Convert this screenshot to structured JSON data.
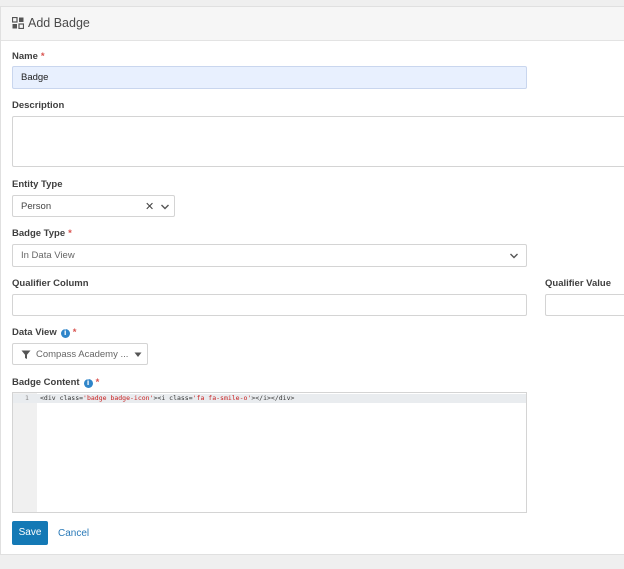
{
  "panel": {
    "title": "Add Badge",
    "icon": "badge-add-icon"
  },
  "fields": {
    "name": {
      "label": "Name",
      "required_mark": "*",
      "value": "Badge"
    },
    "description": {
      "label": "Description",
      "value": ""
    },
    "entity_type": {
      "label": "Entity Type",
      "value": "Person",
      "clear_glyph": "✕"
    },
    "badge_type": {
      "label": "Badge Type",
      "required_mark": "*",
      "value": "In Data View"
    },
    "qualifier_column": {
      "label": "Qualifier Column",
      "value": ""
    },
    "qualifier_value": {
      "label": "Qualifier Value",
      "value": ""
    },
    "data_view": {
      "label": "Data View",
      "required_mark": "*",
      "info_glyph": "i",
      "value": "Compass Academy ..."
    },
    "badge_content": {
      "label": "Badge Content",
      "required_mark": "*",
      "info_glyph": "i",
      "line_number": "1",
      "code_parts": [
        "<div class=",
        "'badge badge-icon'",
        "><i class=",
        "'fa fa-smile-o'",
        "></i></div>"
      ]
    }
  },
  "actions": {
    "save_label": "Save",
    "cancel_label": "Cancel"
  },
  "colors": {
    "primary": "#1479b5",
    "required": "#d9534f",
    "input_highlight": "#e8f0fe",
    "info": "#2f85c9"
  }
}
